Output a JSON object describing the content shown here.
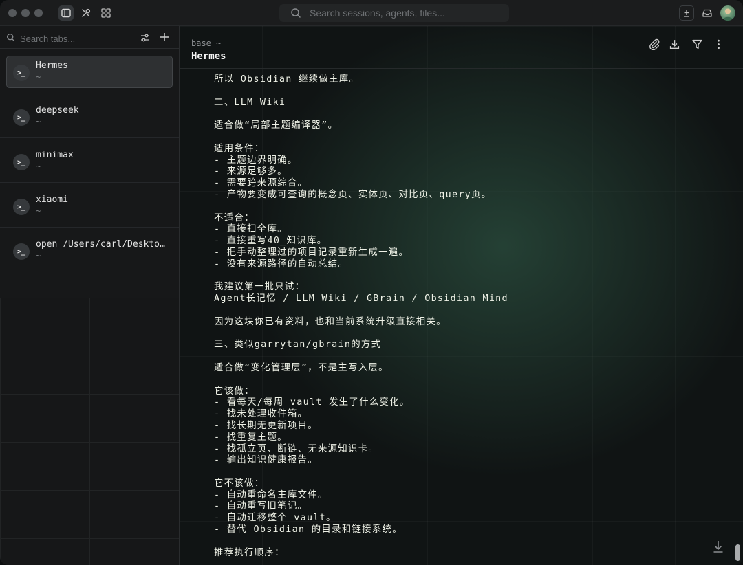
{
  "titlebar": {
    "search_placeholder": "Search sessions, agents, files..."
  },
  "sidebar": {
    "search_placeholder": "Search tabs...",
    "tabs": [
      {
        "name": "Hermes",
        "path": "~",
        "selected": true
      },
      {
        "name": "deepseek",
        "path": "~"
      },
      {
        "name": "minimax",
        "path": "~"
      },
      {
        "name": "xiaomi",
        "path": "~"
      },
      {
        "name": "open /Users/carl/Desktop/...",
        "path": "~"
      }
    ],
    "tab_icon_glyph": ">_"
  },
  "main": {
    "path": "base ~",
    "title": "Hermes",
    "lines": [
      "所以 Obsidian 继续做主库。",
      "",
      "二、LLM Wiki",
      "",
      "适合做“局部主题编译器”。",
      "",
      "适用条件：",
      "- 主题边界明确。",
      "- 来源足够多。",
      "- 需要跨来源综合。",
      "- 产物要变成可查询的概念页、实体页、对比页、query页。",
      "",
      "不适合：",
      "- 直接扫全库。",
      "- 直接重写40_知识库。",
      "- 把手动整理过的项目记录重新生成一遍。",
      "- 没有来源路径的自动总结。",
      "",
      "我建议第一批只试：",
      "Agent长记忆 / LLM Wiki / GBrain / Obsidian Mind",
      "",
      "因为这块你已有资料，也和当前系统升级直接相关。",
      "",
      "三、类似garrytan/gbrain的方式",
      "",
      "适合做“变化管理层”，不是主写入层。",
      "",
      "它该做：",
      "- 看每天/每周 vault 发生了什么变化。",
      "- 找未处理收件箱。",
      "- 找长期无更新项目。",
      "- 找重复主题。",
      "- 找孤立页、断链、无来源知识卡。",
      "- 输出知识健康报告。",
      "",
      "它不该做：",
      "- 自动重命名主库文件。",
      "- 自动重写旧笔记。",
      "- 自动迁移整个 vault。",
      "- 替代 Obsidian 的目录和链接系统。",
      "",
      "推荐执行顺序："
    ]
  }
}
